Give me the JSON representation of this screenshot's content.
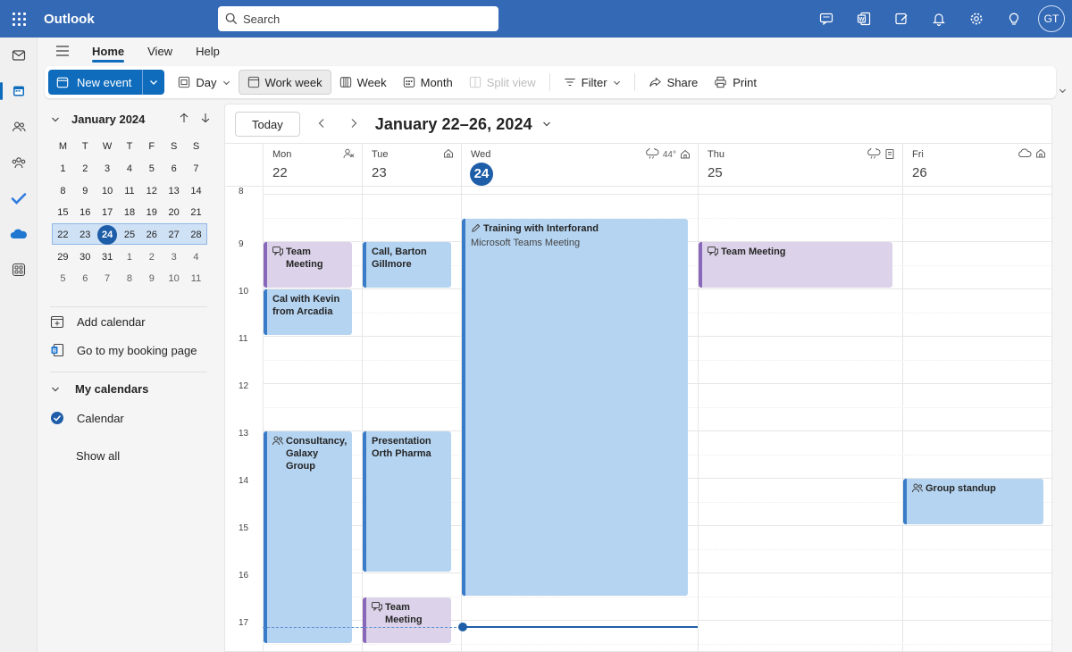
{
  "colors": {
    "brand": "#3469b5",
    "accent": "#0f6cbd",
    "today": "#1e5ea8",
    "event_blue": "#b5d4f1",
    "event_purple": "#dcd3ea"
  },
  "app": {
    "title": "Outlook"
  },
  "search": {
    "placeholder": "Search"
  },
  "topbar": {
    "icons": [
      "teams-chat-icon",
      "office-word-icon",
      "edit-note-icon",
      "bell-icon",
      "gear-icon",
      "lightbulb-icon"
    ],
    "avatar": "GT"
  },
  "rail": [
    "mail-icon",
    "calendar-icon",
    "people-icon",
    "groups-icon",
    "todo-icon",
    "onedrive-icon",
    "apps-icon"
  ],
  "menu": {
    "tabs": [
      "Home",
      "View",
      "Help"
    ],
    "active": "Home"
  },
  "ribbon": {
    "new_event": "New event",
    "day": "Day",
    "work_week": "Work week",
    "week": "Week",
    "month": "Month",
    "split_view": "Split view",
    "filter": "Filter",
    "share": "Share",
    "print": "Print"
  },
  "mini_calendar": {
    "title": "January 2024",
    "dow": [
      "M",
      "T",
      "W",
      "T",
      "F",
      "S",
      "S"
    ],
    "weeks": [
      [
        "1",
        "2",
        "3",
        "4",
        "5",
        "6",
        "7"
      ],
      [
        "8",
        "9",
        "10",
        "11",
        "12",
        "13",
        "14"
      ],
      [
        "15",
        "16",
        "17",
        "18",
        "19",
        "20",
        "21"
      ],
      [
        "22",
        "23",
        "24",
        "25",
        "26",
        "27",
        "28"
      ],
      [
        "29",
        "30",
        "31",
        "1",
        "2",
        "3",
        "4"
      ],
      [
        "5",
        "6",
        "7",
        "8",
        "9",
        "10",
        "11"
      ]
    ],
    "today": "24"
  },
  "left_panel": {
    "add_calendar": "Add calendar",
    "booking_page": "Go to my booking page",
    "my_calendars": "My calendars",
    "calendar": "Calendar",
    "show_all": "Show all"
  },
  "calendar": {
    "today_button": "Today",
    "range_title": "January 22–26, 2024",
    "days": [
      {
        "name": "Mon",
        "num": "22",
        "weather": ""
      },
      {
        "name": "Tue",
        "num": "23",
        "weather": ""
      },
      {
        "name": "Wed",
        "num": "24",
        "weather": "44°"
      },
      {
        "name": "Thu",
        "num": "25",
        "weather": ""
      },
      {
        "name": "Fri",
        "num": "26",
        "weather": ""
      }
    ],
    "hours": [
      "8",
      "9",
      "10",
      "11",
      "12",
      "13",
      "14",
      "15",
      "16",
      "17"
    ],
    "events": [
      {
        "title": "Team Meeting",
        "sub": "",
        "day": 0,
        "start": 9.0,
        "end": 10.0,
        "color": "purple",
        "icon": "chat"
      },
      {
        "title": "Cal with Kevin from Arcadia",
        "sub": "",
        "day": 0,
        "start": 10.0,
        "end": 11.0,
        "color": "blue",
        "icon": ""
      },
      {
        "title": "Consultancy, Galaxy Group",
        "sub": "",
        "day": 0,
        "start": 13.0,
        "end": 17.5,
        "color": "blue",
        "icon": "people"
      },
      {
        "title": "Call, Barton Gillmore",
        "sub": "",
        "day": 1,
        "start": 9.0,
        "end": 10.0,
        "color": "blue",
        "icon": ""
      },
      {
        "title": "Presentation Orth Pharma",
        "sub": "",
        "day": 1,
        "start": 13.0,
        "end": 16.0,
        "color": "blue",
        "icon": ""
      },
      {
        "title": "Team Meeting",
        "sub": "",
        "day": 1,
        "start": 16.5,
        "end": 17.5,
        "color": "purple",
        "icon": "chat"
      },
      {
        "title": "Training with Interforand",
        "sub": "Microsoft Teams Meeting",
        "day": 2,
        "start": 8.5,
        "end": 16.5,
        "color": "blue",
        "icon": "edit"
      },
      {
        "title": "Team Meeting",
        "sub": "",
        "day": 3,
        "start": 9.0,
        "end": 10.0,
        "color": "purple",
        "icon": "chat"
      },
      {
        "title": "Group standup",
        "sub": "",
        "day": 4,
        "start": 14.0,
        "end": 15.0,
        "color": "blue",
        "icon": "people"
      }
    ]
  }
}
